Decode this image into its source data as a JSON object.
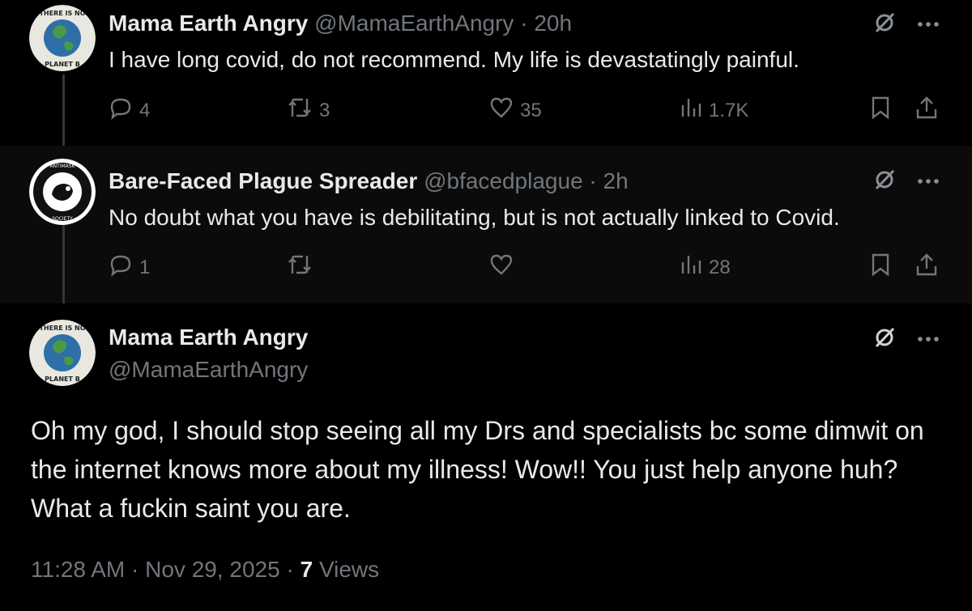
{
  "tweets": [
    {
      "name": "Mama Earth Angry",
      "handle": "@MamaEarthAngry",
      "sep": "·",
      "time": "20h",
      "text": "I have long covid, do not recommend. My life is devastatingly painful.",
      "replies": "4",
      "reposts": "3",
      "likes": "35",
      "views": "1.7K"
    },
    {
      "name": "Bare-Faced Plague Spreader",
      "handle": "@bfacedplague",
      "sep": "·",
      "time": "2h",
      "text": "No doubt what you have is debilitating, but is not actually linked to Covid.",
      "replies": "1",
      "reposts": "",
      "likes": "",
      "views": "28"
    }
  ],
  "main": {
    "name": "Mama Earth Angry",
    "handle": "@MamaEarthAngry",
    "text": "Oh my god, I should stop seeing all my Drs and specialists bc some dimwit on the internet knows more about my illness! Wow!! You just help anyone huh? What a fuckin saint you are.",
    "time": "11:28 AM",
    "sep1": "·",
    "date": "Nov 29, 2025",
    "sep2": "·",
    "views_count": "7",
    "views_label": "Views"
  },
  "icons": [
    "reply-icon",
    "repost-icon",
    "like-icon",
    "views-icon",
    "bookmark-icon",
    "share-icon",
    "grok-icon",
    "more-icon"
  ],
  "colors": {
    "background": "#000000",
    "text": "#e7e9ea",
    "secondary": "#71767b"
  }
}
